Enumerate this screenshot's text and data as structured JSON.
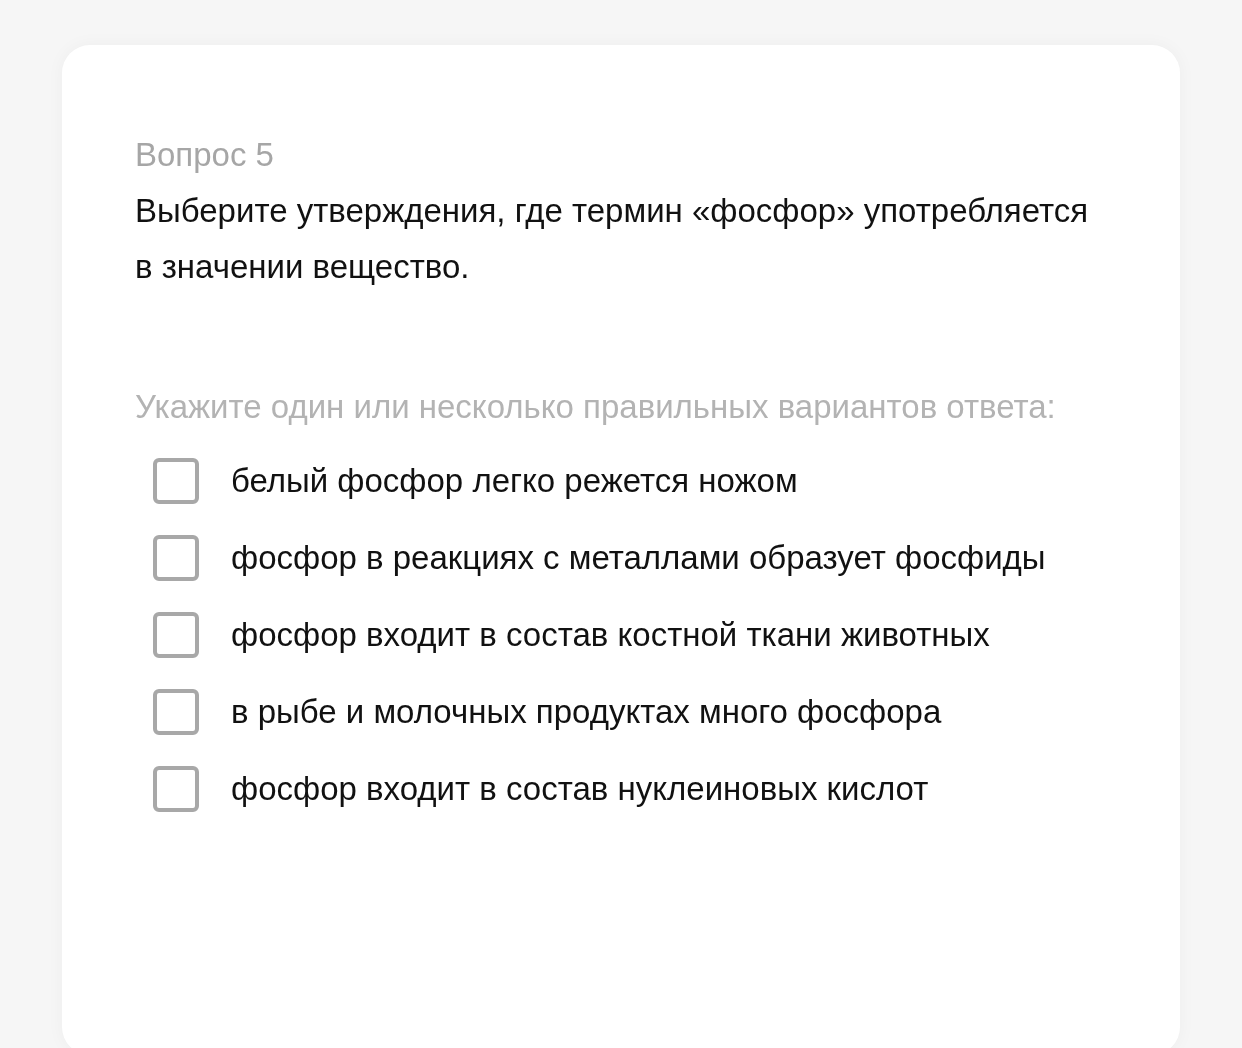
{
  "question": {
    "number": "Вопрос 5",
    "text": "Выберите утверждения, где термин «фосфор» употребляется в значении вещество.",
    "hint": "Укажите один или несколько правильных вариантов ответа:"
  },
  "options": [
    {
      "label": "белый фосфор легко режется ножом",
      "checked": false
    },
    {
      "label": "фосфор в реакциях с металлами образует фосфиды",
      "checked": false
    },
    {
      "label": "фосфор входит в состав костной ткани животных",
      "checked": false
    },
    {
      "label": "в рыбе и молочных продуктах много фосфора",
      "checked": false
    },
    {
      "label": "фосфор входит в состав нуклеиновых кислот",
      "checked": false
    }
  ]
}
